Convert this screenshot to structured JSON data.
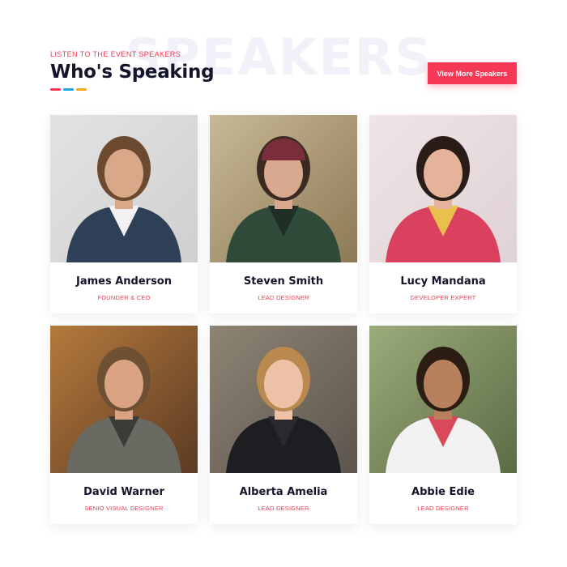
{
  "header": {
    "watermark": "SPEAKERS",
    "eyebrow": "LISTEN TO THE EVENT SPEAKERS",
    "title": "Who's Speaking",
    "underline_colors": [
      "#f53855",
      "#1ea7e8",
      "#f5a623"
    ],
    "cta_label": "View More Speakers"
  },
  "colors": {
    "accent": "#f53855",
    "heading": "#14142b"
  },
  "speakers": [
    {
      "name": "James Anderson",
      "role": "FOUNDER & CEO",
      "bg": "#e3e3e3",
      "bg2": "#cfcfcf",
      "skin": "#d9a888",
      "hair": "#6b4a2f",
      "shirt": "#2e3f58",
      "inner": "#f2f2f2"
    },
    {
      "name": "Steven Smith",
      "role": "LEAD DESIGNER",
      "bg": "#c9b896",
      "bg2": "#8c7a55",
      "skin": "#d8a98e",
      "hair": "#3b2a22",
      "shirt": "#2f4a38",
      "inner": "#1f2f25",
      "hat": "#7a2e3a"
    },
    {
      "name": "Lucy Mandana",
      "role": "DEVELOPER EXPERT",
      "bg": "#efe4e6",
      "bg2": "#e0d2d5",
      "skin": "#e4b39a",
      "hair": "#2a1d18",
      "shirt": "#d9415f",
      "inner": "#e8c04a"
    },
    {
      "name": "David Warner",
      "role": "SENIO VISUAL DESIGNER",
      "bg": "#b57a3c",
      "bg2": "#5c3a23",
      "skin": "#d9a384",
      "hair": "#6e5034",
      "shirt": "#6a6a62",
      "inner": "#3d3b37"
    },
    {
      "name": "Alberta Amelia",
      "role": "LEAD DESIGNER",
      "bg": "#8e8475",
      "bg2": "#5c554c",
      "skin": "#ecc1a6",
      "hair": "#b9894f",
      "shirt": "#1e1e22",
      "inner": "#2a2a2e"
    },
    {
      "name": "Abbie Edie",
      "role": "LEAD DESIGNER",
      "bg": "#9cab7a",
      "bg2": "#5b6c45",
      "skin": "#b9805d",
      "hair": "#2b1c14",
      "shirt": "#f2f2f2",
      "inner": "#d9495a"
    }
  ]
}
